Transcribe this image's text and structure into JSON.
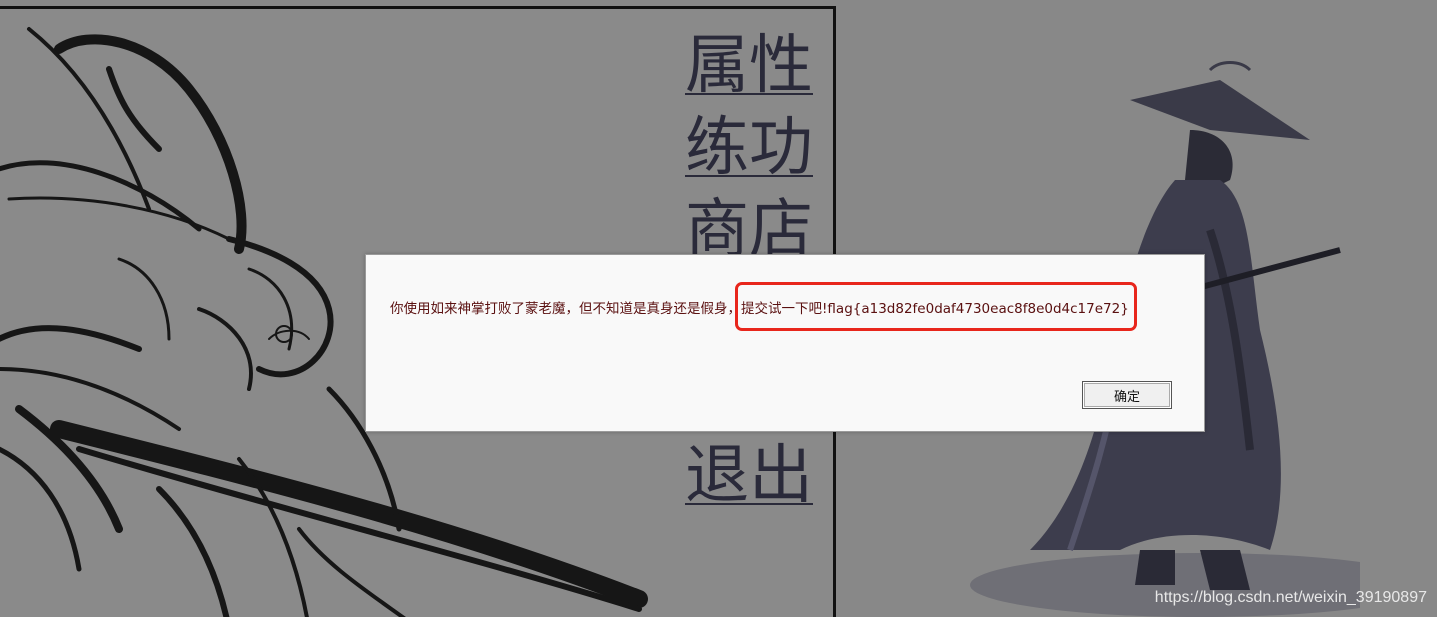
{
  "menu": {
    "items": [
      {
        "label": "属性"
      },
      {
        "label": "练功"
      },
      {
        "label": "商店"
      }
    ],
    "exit_label": "退出"
  },
  "dialog": {
    "message_prefix": "你使用如来神掌打败了蒙老魔，但不知道是真身还是假身，",
    "message_flag": "提交试一下吧!flag{a13d82fe0daf4730eac8f8e0d4c17e72}",
    "ok_label": "确定"
  },
  "watermark": "https://blog.csdn.net/weixin_39190897",
  "colors": {
    "background": "#888888",
    "dialog_text": "#5a1010",
    "highlight_border": "#e8261c"
  }
}
